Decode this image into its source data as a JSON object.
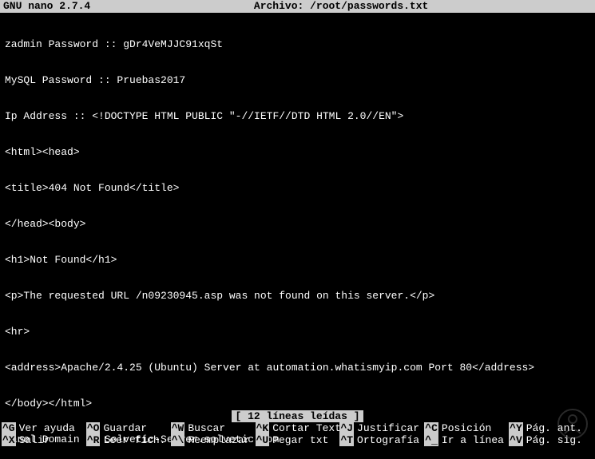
{
  "header": {
    "app": "GNU nano 2.7.4",
    "file_label": "Archivo: /root/passwords.txt"
  },
  "content": {
    "lines": [
      "zadmin Password :: gDr4VeMJJC91xqSt",
      "MySQL Password :: Pruebas2017",
      "Ip Address :: <!DOCTYPE HTML PUBLIC \"-//IETF//DTD HTML 2.0//EN\">",
      "<html><head>",
      "<title>404 Not Found</title>",
      "</head><body>",
      "<h1>Not Found</h1>",
      "<p>The requested URL /n09230945.asp was not found on this server.</p>",
      "<hr>",
      "<address>Apache/2.4.25 (Ubuntu) Server at automation.whatismyip.com Port 80</address>",
      "</body></html>",
      "Panel Domain :: Solvetic-Server.solvetic.com"
    ]
  },
  "status": {
    "text": "[ 12 líneas leídas ]"
  },
  "help": {
    "row1": [
      {
        "key": "^G",
        "label": "Ver ayuda"
      },
      {
        "key": "^O",
        "label": "Guardar"
      },
      {
        "key": "^W",
        "label": "Buscar"
      },
      {
        "key": "^K",
        "label": "Cortar Text"
      },
      {
        "key": "^J",
        "label": "Justificar"
      },
      {
        "key": "^C",
        "label": "Posición"
      },
      {
        "key": "^Y",
        "label": "Pág. ant."
      }
    ],
    "row2": [
      {
        "key": "^X",
        "label": "Salir"
      },
      {
        "key": "^R",
        "label": "Leer fich."
      },
      {
        "key": "^\\",
        "label": "Reemplazar"
      },
      {
        "key": "^U",
        "label": "Pegar txt"
      },
      {
        "key": "^T",
        "label": "Ortografía"
      },
      {
        "key": "^_",
        "label": "Ir a línea"
      },
      {
        "key": "^V",
        "label": "Pág. sig."
      }
    ]
  }
}
